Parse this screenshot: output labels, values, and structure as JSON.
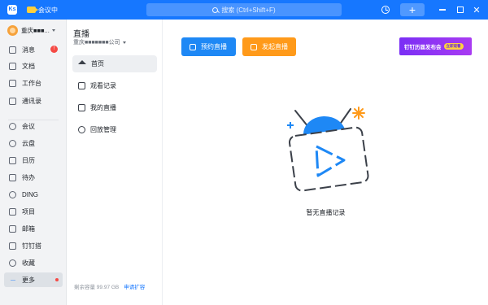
{
  "titlebar": {
    "logo": "Ks",
    "meeting_indicator": "会议中",
    "search_placeholder": "搜索 (Ctrl+Shift+F)",
    "plus": "+",
    "close": "✕"
  },
  "leftnav": {
    "org_name": "重庆■■■...",
    "items": [
      {
        "label": "消息",
        "badge": "!"
      },
      {
        "label": "文档"
      },
      {
        "label": "工作台"
      },
      {
        "label": "通讯录"
      },
      {
        "label": "会议"
      },
      {
        "label": "云盘"
      },
      {
        "label": "日历"
      },
      {
        "label": "待办"
      },
      {
        "label": "DING"
      },
      {
        "label": "项目"
      },
      {
        "label": "邮箱"
      },
      {
        "label": "钉钉搭"
      },
      {
        "label": "收藏"
      },
      {
        "label": "更多",
        "dots": "···"
      }
    ]
  },
  "subpanel": {
    "title": "直播",
    "org": "重庆■■■■■■■公司",
    "items": [
      {
        "label": "首页"
      },
      {
        "label": "观看记录"
      },
      {
        "label": "我的直播"
      },
      {
        "label": "回放管理"
      }
    ],
    "storage_text": "剩余容量 99.97 GB",
    "expand_link": "申请扩容"
  },
  "main": {
    "book_button": "预约直播",
    "start_button": "发起直播",
    "banner_text": "钉钉历届发布会",
    "banner_pill": "立即观看",
    "empty_text": "暂无直播记录"
  },
  "colors": {
    "brand_blue": "#1677ff",
    "book_blue": "#1e88f5",
    "start_orange": "#ff9a1a",
    "banner_purple": "#7a2ff5"
  }
}
